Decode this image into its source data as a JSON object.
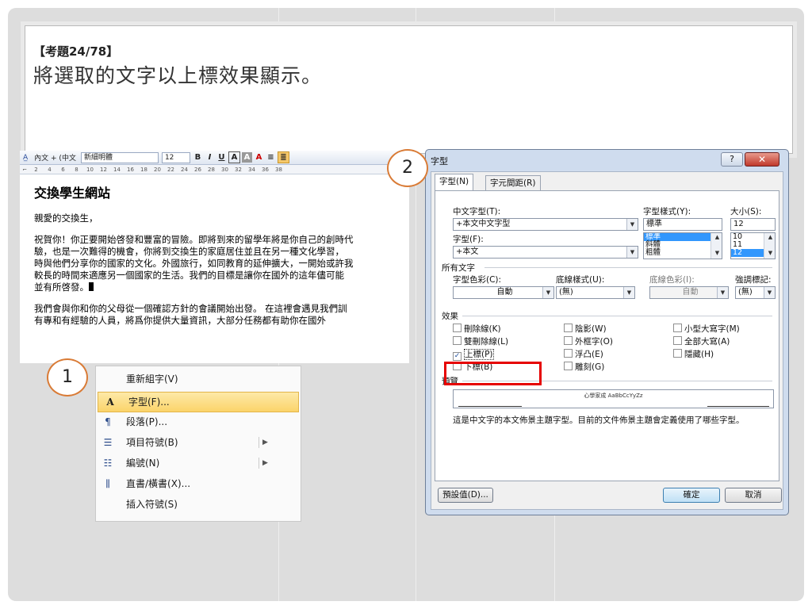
{
  "question": {
    "number": "【考題24/78】",
    "text": "將選取的文字以上標效果顯示。"
  },
  "word": {
    "toolbar": {
      "style": "內文 + (中文",
      "font": "新細明體",
      "size": "12",
      "buttons": [
        "B",
        "I",
        "U",
        "A",
        "A",
        "A"
      ]
    },
    "ruler": [
      "2",
      "4",
      "6",
      "8",
      "10",
      "12",
      "14",
      "16",
      "18",
      "20",
      "22",
      "24",
      "26",
      "28",
      "30",
      "32",
      "34",
      "36",
      "38"
    ],
    "doc": {
      "heading": "交換學生網站",
      "greeting": "親愛的交換生，",
      "para1": [
        "祝賀你！你正要開始啓發和豐富的冒險。即將到來的留學年將是你自己的創時代",
        "驗，也是一次難得的機會，你將到交換生的家庭居住並且在另一種文化學習，",
        "時與他們分享你的國家的文化。外國旅行，如同教育的延伸擴大，一開始或許我",
        "較長的時間來適應另一個國家的生活。我們的目標是讓你在國外的這年儘可能",
        "並有所啓發。"
      ],
      "para2": [
        "我們會與你和你的父母從一個確認方針的會議開始出發。 在這裡會遇見我們訓",
        "有專和有經驗的人員，將爲你提供大量資訊，大部分任務都有助你在國外"
      ]
    }
  },
  "context_menu": {
    "items": [
      {
        "icon": "",
        "label": "重新組字(V)",
        "submenu": false
      },
      {
        "icon": "A",
        "label": "字型(F)...",
        "submenu": false
      },
      {
        "icon": "¶",
        "label": "段落(P)...",
        "submenu": false
      },
      {
        "icon": "☰",
        "label": "項目符號(B)",
        "submenu": true
      },
      {
        "icon": "☷",
        "label": "編號(N)",
        "submenu": true
      },
      {
        "icon": "⫼",
        "label": "直書/橫書(X)...",
        "submenu": false
      },
      {
        "icon": "",
        "label": "插入符號(S)",
        "submenu": false
      }
    ]
  },
  "dialog": {
    "title": "字型",
    "help": "?",
    "close": "✕",
    "tabs": [
      "字型(N)",
      "字元間距(R)"
    ],
    "labels": {
      "cjk_font": "中文字型(T):",
      "font": "字型(F):",
      "style": "字型樣式(Y):",
      "size": "大小(S):",
      "all_text": "所有文字",
      "color": "字型色彩(C):",
      "underline_style": "底線樣式(U):",
      "underline_color": "底線色彩(I):",
      "emphasis": "強調標記:",
      "effects": "效果",
      "preview": "預覽"
    },
    "values": {
      "cjk_font": "+本文中文字型",
      "font": "+本文",
      "style": "標準",
      "size": "12",
      "color": "自動",
      "underline_style": "(無)",
      "underline_color": "自動",
      "emphasis": "(無)"
    },
    "style_list": [
      "標準",
      "斜體",
      "粗體"
    ],
    "size_list": [
      "10",
      "11",
      "12"
    ],
    "effects": [
      {
        "label": "刪除線(K)",
        "checked": false
      },
      {
        "label": "雙刪除線(L)",
        "checked": false
      },
      {
        "label": "上標(P)",
        "checked": true
      },
      {
        "label": "下標(B)",
        "checked": false
      },
      {
        "label": "陰影(W)",
        "checked": false
      },
      {
        "label": "外框字(O)",
        "checked": false
      },
      {
        "label": "浮凸(E)",
        "checked": false
      },
      {
        "label": "雕刻(G)",
        "checked": false
      },
      {
        "label": "小型大寫字(M)",
        "checked": false
      },
      {
        "label": "全部大寫(A)",
        "checked": false
      },
      {
        "label": "隱藏(H)",
        "checked": false
      }
    ],
    "preview_text": "心學家成 AaBbCcYyZz",
    "note": "這是中文字的本文佈景主題字型。目前的文件佈景主題會定義使用了哪些字型。",
    "buttons": {
      "default": "預設值(D)...",
      "ok": "確定",
      "cancel": "取消"
    }
  },
  "callouts": [
    "1",
    "2"
  ],
  "colors": {
    "highlight": "#e60000",
    "callout_border": "#d97b36",
    "accent": "#3297fd"
  }
}
